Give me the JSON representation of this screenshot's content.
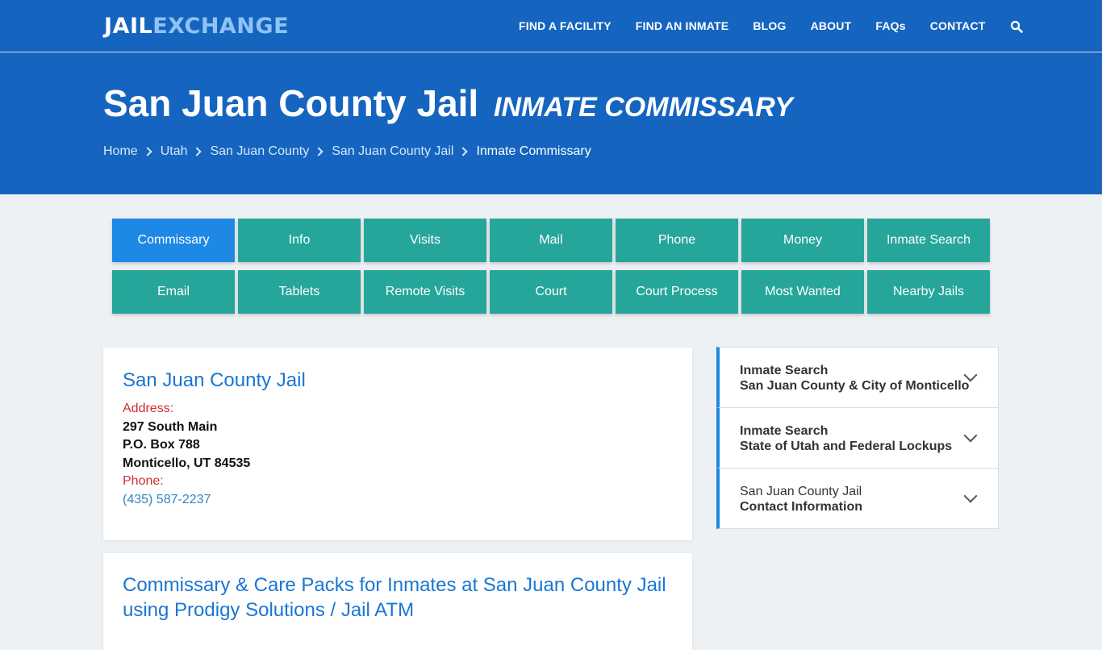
{
  "brand": {
    "part1": "JAIL",
    "part2": "EXCHANGE"
  },
  "nav": {
    "items": [
      "FIND A FACILITY",
      "FIND AN INMATE",
      "BLOG",
      "ABOUT",
      "FAQs",
      "CONTACT"
    ],
    "search_icon": "search-icon"
  },
  "hero": {
    "title": "San Juan County Jail",
    "subtitle": "Inmate Commissary",
    "breadcrumb": [
      "Home",
      "Utah",
      "San Juan County",
      "San Juan County Jail"
    ],
    "breadcrumb_current": "Inmate Commissary"
  },
  "tabs": [
    "Commissary",
    "Info",
    "Visits",
    "Mail",
    "Phone",
    "Money",
    "Inmate Search",
    "Email",
    "Tablets",
    "Remote Visits",
    "Court",
    "Court Process",
    "Most Wanted",
    "Nearby Jails"
  ],
  "contact_card": {
    "title": "San Juan County Jail",
    "address_label": "Address:",
    "address_lines": [
      "297 South Main",
      "P.O. Box 788",
      "Monticello, UT 84535"
    ],
    "phone_label": "Phone:",
    "phone": "(435) 587-2237"
  },
  "commissary_card": {
    "title": "Commissary & Care Packs for Inmates at San Juan County Jail using Prodigy Solutions / Jail ATM"
  },
  "sidebar": [
    {
      "line1": "Inmate Search",
      "line2": "San Juan County & City of Monticello"
    },
    {
      "line1": "Inmate Search",
      "line2": "State of Utah and Federal Lockups"
    },
    {
      "line1": "San Juan County Jail",
      "line2": "Contact Information"
    }
  ],
  "colors": {
    "primary": "#1565c0",
    "tab": "#26a69a",
    "tab_active": "#1e88e5",
    "label_red": "#d32f2f"
  }
}
